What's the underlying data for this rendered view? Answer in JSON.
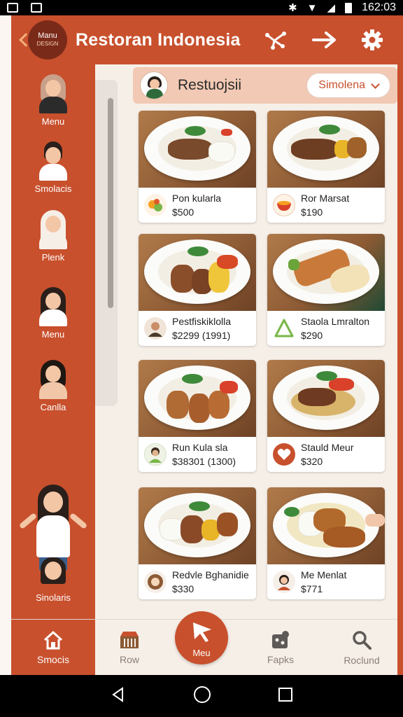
{
  "status_bar": {
    "time": "162:03"
  },
  "app": {
    "title": "Restoran Indonesia",
    "logo_line1": "Manu",
    "logo_line2": "DESIGN"
  },
  "header_actions": [
    "share-icon",
    "forward-arrow-icon",
    "gear-icon"
  ],
  "sidebar": {
    "items": [
      {
        "label": "Menu"
      },
      {
        "label": "Smolacis"
      },
      {
        "label": "Plenk"
      },
      {
        "label": "Menu"
      },
      {
        "label": "Canlla"
      }
    ],
    "bottom_label": "Sinolaris"
  },
  "content": {
    "title": "Restuojsii",
    "dropdown": "Simolena"
  },
  "cards": [
    {
      "name": "Pon kularla",
      "price": "$500"
    },
    {
      "name": "Ror Marsat",
      "price": "$190"
    },
    {
      "name": "Pestfiskiklolla",
      "price": "$2299 (1991)"
    },
    {
      "name": "Staola Lmralton",
      "price": "$290"
    },
    {
      "name": "Run Kula sla",
      "price": "$38301 (1300)"
    },
    {
      "name": "Stauld Meur",
      "price": "$320"
    },
    {
      "name": "Redvle Bghanidie",
      "price": "$330"
    },
    {
      "name": "Me Menlat",
      "price": "$771"
    }
  ],
  "bottom_nav": {
    "home": "Smocis",
    "row": "Row",
    "center": "Meu",
    "fapks": "Fapks",
    "search": "Roclund"
  },
  "colors": {
    "primary": "#c8502d",
    "background": "#f6efe8"
  }
}
